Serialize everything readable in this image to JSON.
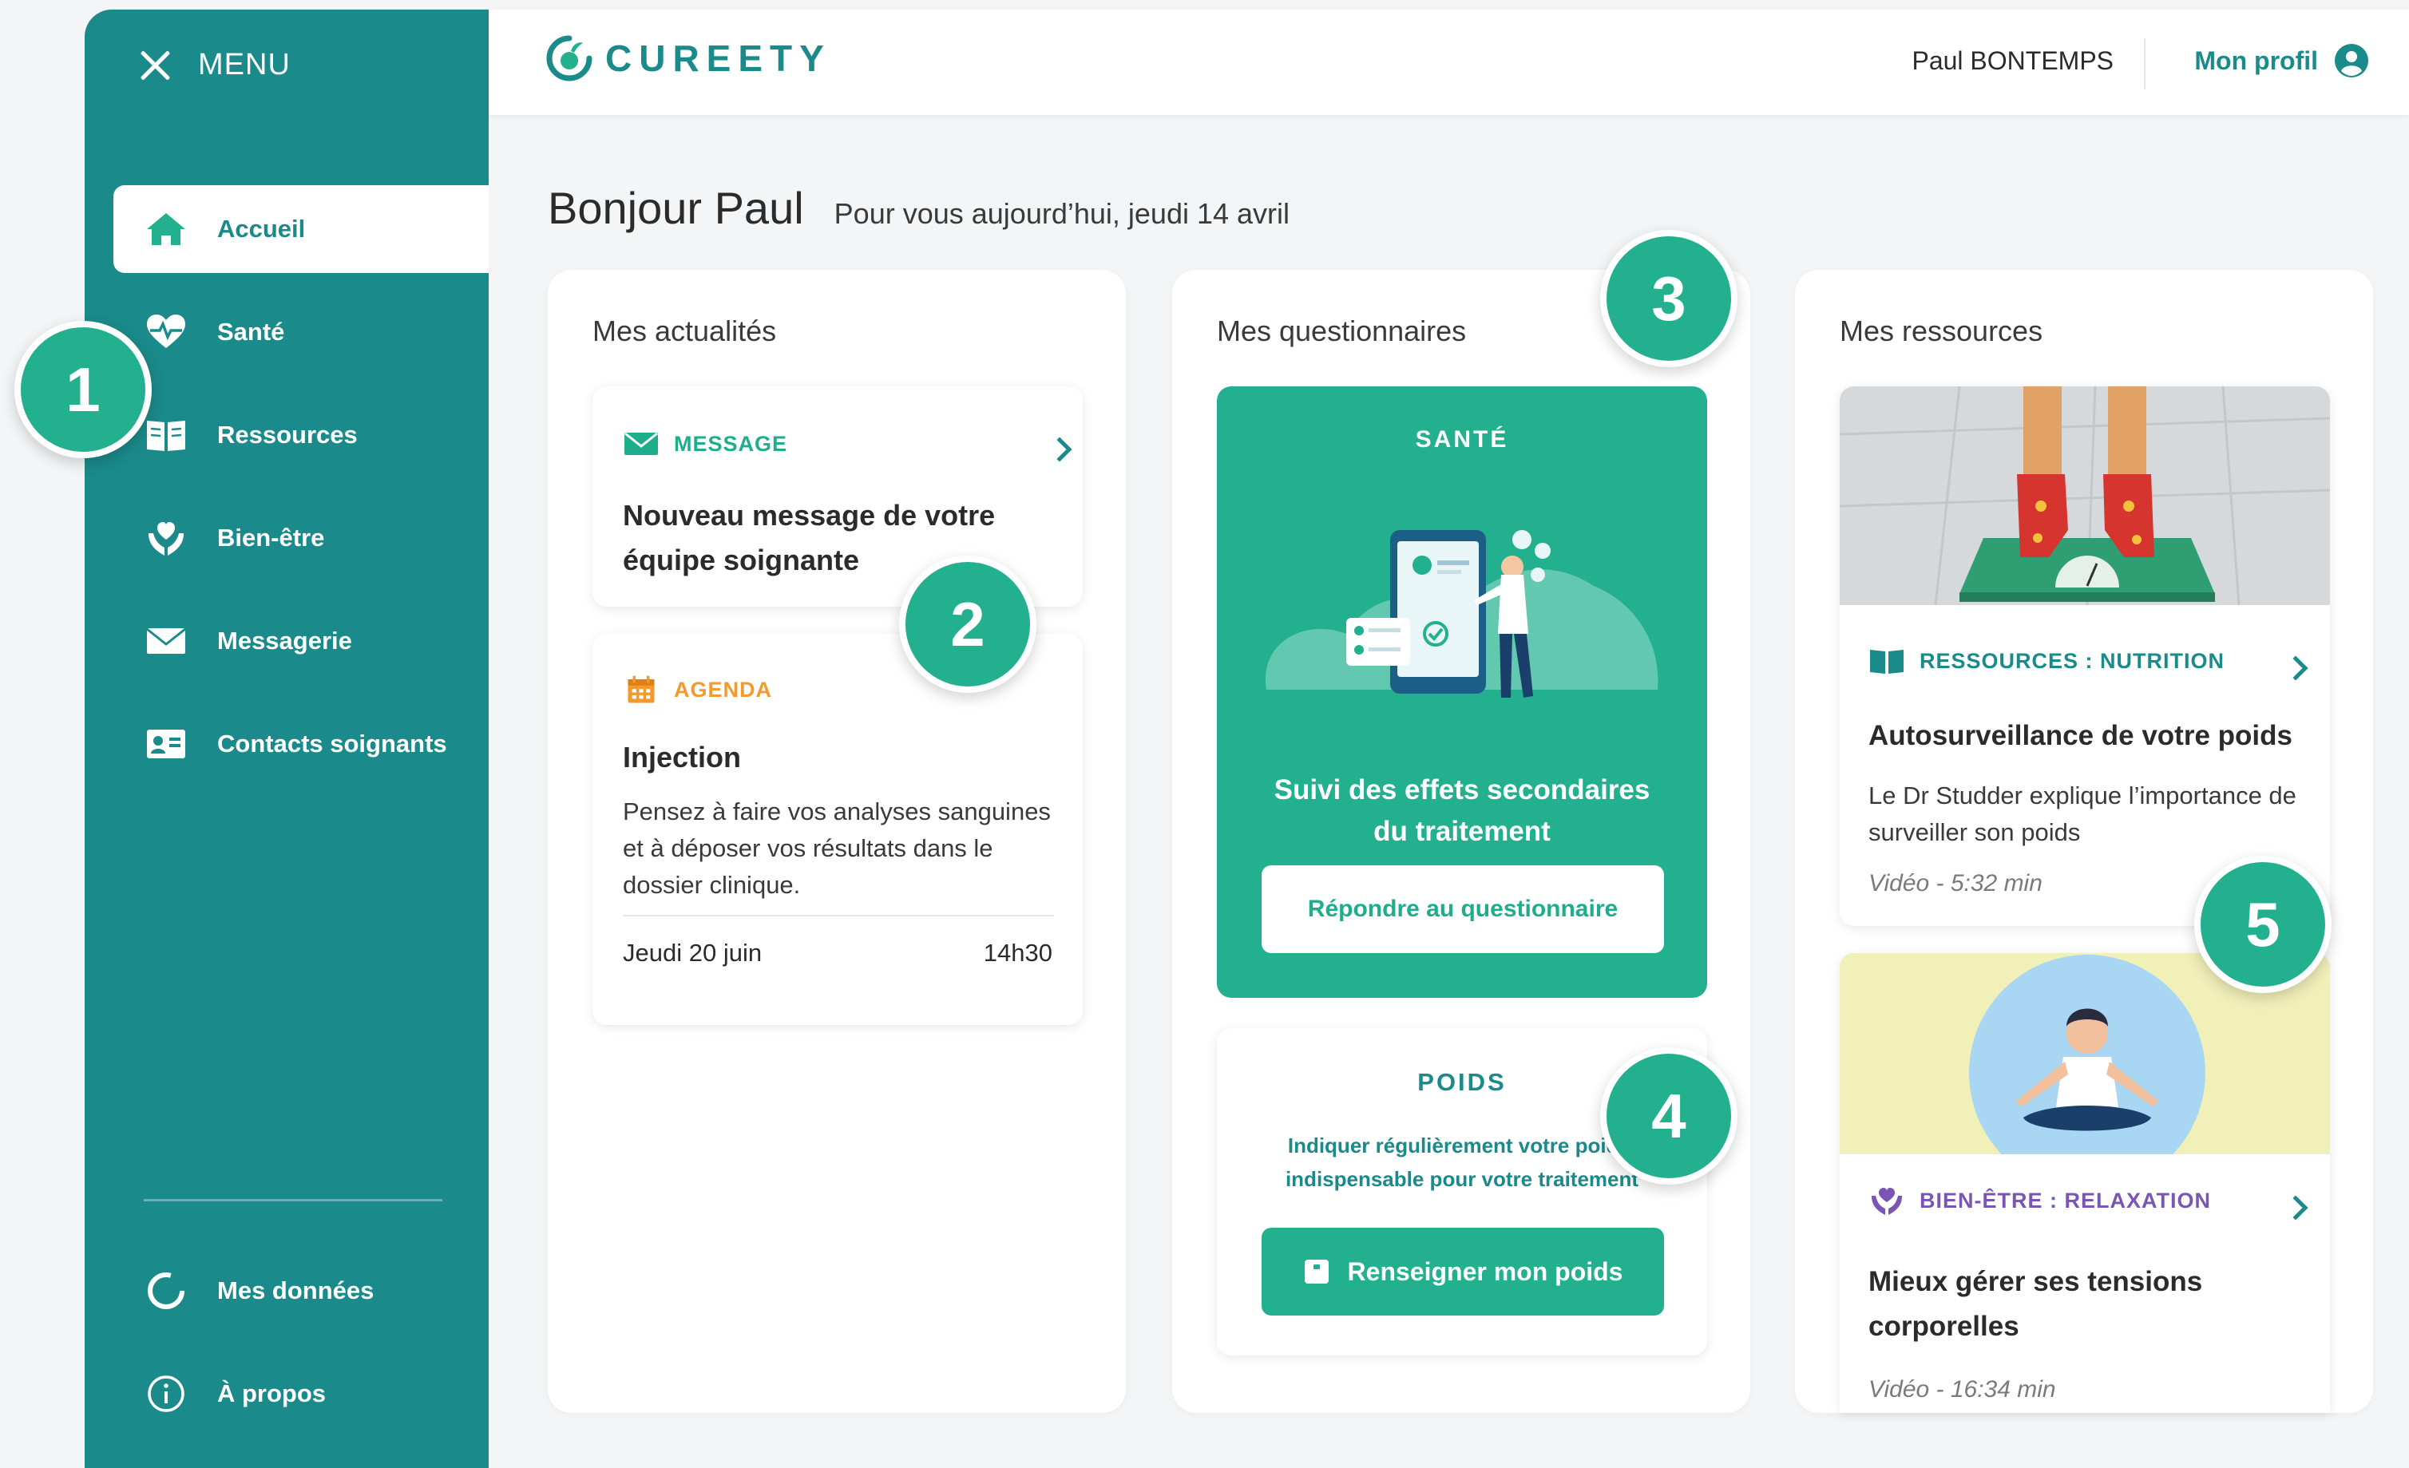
{
  "sidebar": {
    "menu_label": "MENU",
    "items": [
      {
        "label": "Accueil",
        "icon": "home-icon",
        "active": true
      },
      {
        "label": "Santé",
        "icon": "heart-pulse-icon"
      },
      {
        "label": "Ressources",
        "icon": "book-icon"
      },
      {
        "label": "Bien-être",
        "icon": "hands-heart-icon"
      },
      {
        "label": "Messagerie",
        "icon": "envelope-icon"
      },
      {
        "label": "Contacts soignants",
        "icon": "contact-card-icon"
      }
    ],
    "bottom_items": [
      {
        "label": "Mes données",
        "icon": "donut-chart-icon"
      },
      {
        "label": "À propos",
        "icon": "info-icon"
      }
    ]
  },
  "header": {
    "logo_text": "CUREETY",
    "user_name": "Paul BONTEMPS",
    "profile_label": "Mon profil"
  },
  "greeting": {
    "hello": "Bonjour Paul",
    "date": "Pour vous aujourd’hui, jeudi 14 avril"
  },
  "news": {
    "title": "Mes actualités",
    "message": {
      "tag": "MESSAGE",
      "title": "Nouveau message de votre équipe soignante"
    },
    "agenda": {
      "tag": "AGENDA",
      "title": "Injection",
      "desc": "Pensez à faire vos analyses sanguines et à déposer vos résultats dans le dossier clinique.",
      "date": "Jeudi 20 juin",
      "time": "14h30"
    }
  },
  "questionnaires": {
    "title": "Mes questionnaires",
    "health": {
      "category": "SANTÉ",
      "desc": "Suivi des effets secondaires du traitement",
      "button": "Répondre au questionnaire"
    },
    "weight": {
      "category": "POIDS",
      "desc": "Indiquer régulièrement votre poids, indispensable pour votre traitement",
      "button": "Renseigner mon poids"
    }
  },
  "resources": {
    "title": "Mes ressources",
    "items": [
      {
        "tag": "RESSOURCES : NUTRITION",
        "title": "Autosurveillance de votre poids",
        "desc": "Le Dr Studder explique l’importance de surveiller son poids",
        "meta": "Vidéo - 5:32 min"
      },
      {
        "tag": "BIEN-ÊTRE : RELAXATION",
        "title": "Mieux gérer ses tensions corporelles",
        "meta": "Vidéo - 16:34 min"
      }
    ]
  },
  "badges": [
    "1",
    "2",
    "3",
    "4",
    "5"
  ],
  "colors": {
    "primary": "#1b8a8a",
    "accent": "#23b08f",
    "agenda": "#f29a2e",
    "wellbeing": "#7a55b3",
    "background": "#f3f5f6"
  }
}
